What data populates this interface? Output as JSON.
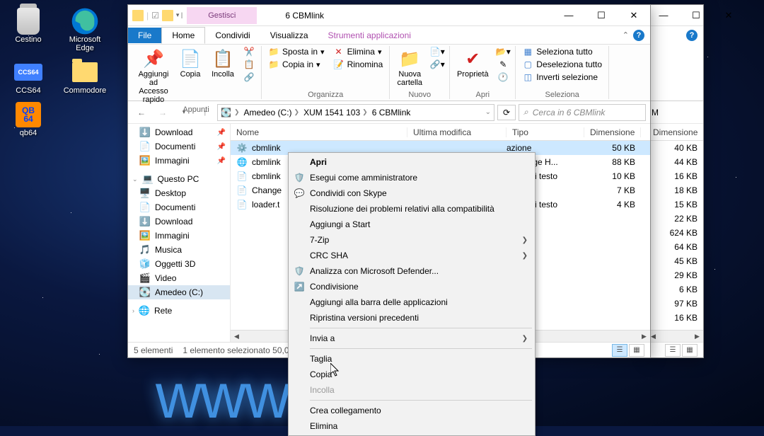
{
  "desktop": {
    "icons": {
      "bin": "Cestino",
      "edge": "Microsoft Edge",
      "ccs": "CCS64",
      "commodore": "Commodore",
      "qb64": "qb64"
    }
  },
  "back_window": {
    "titlebar_right_text": "M",
    "col_dim": "Dimensione",
    "sizes": [
      "40 KB",
      "44 KB",
      "16 KB",
      "18 KB",
      "15 KB",
      "22 KB",
      "624 KB",
      "64 KB",
      "45 KB",
      "29 KB",
      "6 KB",
      "97 KB",
      "16 KB"
    ]
  },
  "window": {
    "title_tab": "Gestisci",
    "title": "6 CBMlink",
    "tabs": {
      "file": "File",
      "home": "Home",
      "condividi": "Condividi",
      "visualizza": "Visualizza",
      "strumenti": "Strumenti applicazioni"
    },
    "ribbon": {
      "appunti": {
        "label": "Appunti",
        "aggiungi": "Aggiungi ad Accesso rapido",
        "copia": "Copia",
        "incolla": "Incolla"
      },
      "organizza": {
        "label": "Organizza",
        "sposta": "Sposta in",
        "copiain": "Copia in",
        "elimina": "Elimina",
        "rinomina": "Rinomina"
      },
      "nuovo": {
        "label": "Nuovo",
        "cartella": "Nuova cartella"
      },
      "apri": {
        "label": "Apri",
        "proprieta": "Proprietà"
      },
      "seleziona": {
        "label": "Seleziona",
        "tutto": "Seleziona tutto",
        "deseleziona": "Deseleziona tutto",
        "inverti": "Inverti selezione"
      }
    },
    "breadcrumbs": [
      "Amedeo (C:)",
      "XUM 1541 103",
      "6 CBMlink"
    ],
    "search_placeholder": "Cerca in 6 CBMlink",
    "nav": {
      "download": "Download",
      "documenti": "Documenti",
      "immagini": "Immagini",
      "questo_pc": "Questo PC",
      "desktop": "Desktop",
      "documenti2": "Documenti",
      "download2": "Download",
      "immagini2": "Immagini",
      "musica": "Musica",
      "oggetti3d": "Oggetti 3D",
      "video": "Video",
      "amedeo": "Amedeo (C:)",
      "rete": "Rete"
    },
    "columns": {
      "name": "Nome",
      "modified": "Ultima modifica",
      "type": "Tipo",
      "size": "Dimensione"
    },
    "files": [
      {
        "name": "cbmlink",
        "type": "azione",
        "size": "50 KB",
        "icon": "app"
      },
      {
        "name": "cbmlink",
        "type": "soft Edge H...",
        "size": "88 KB",
        "icon": "edge"
      },
      {
        "name": "cbmlink",
        "type": "nento di testo",
        "size": "10 KB",
        "icon": "txt"
      },
      {
        "name": "Change",
        "type": "",
        "size": "7 KB",
        "icon": "file"
      },
      {
        "name": "loader.t",
        "type": "nento di testo",
        "size": "4 KB",
        "icon": "txt"
      }
    ],
    "status": {
      "count": "5 elementi",
      "selected": "1 elemento selezionato",
      "size": "50,0"
    }
  },
  "context_menu": {
    "items": [
      {
        "label": "Apri",
        "bold": true
      },
      {
        "label": "Esegui come amministratore",
        "icon": "shield"
      },
      {
        "label": "Condividi con Skype",
        "icon": "skype"
      },
      {
        "label": "Risoluzione dei problemi relativi alla compatibilità"
      },
      {
        "label": "Aggiungi a Start"
      },
      {
        "label": "7-Zip",
        "submenu": true
      },
      {
        "label": "CRC SHA",
        "submenu": true
      },
      {
        "label": "Analizza con Microsoft Defender...",
        "icon": "defender"
      },
      {
        "label": "Condivisione",
        "icon": "share"
      },
      {
        "label": "Aggiungi alla barra delle applicazioni"
      },
      {
        "label": "Ripristina versioni precedenti"
      },
      {
        "sep": true
      },
      {
        "label": "Invia a",
        "submenu": true
      },
      {
        "sep": true
      },
      {
        "label": "Taglia"
      },
      {
        "label": "Copia"
      },
      {
        "label": "Incolla",
        "disabled": true
      },
      {
        "sep": true
      },
      {
        "label": "Crea collegamento"
      },
      {
        "label": "Elimina"
      }
    ]
  },
  "bg_text": "www      o.it",
  "colors": {
    "accent": "#1979ca",
    "select": "#cde8ff"
  }
}
